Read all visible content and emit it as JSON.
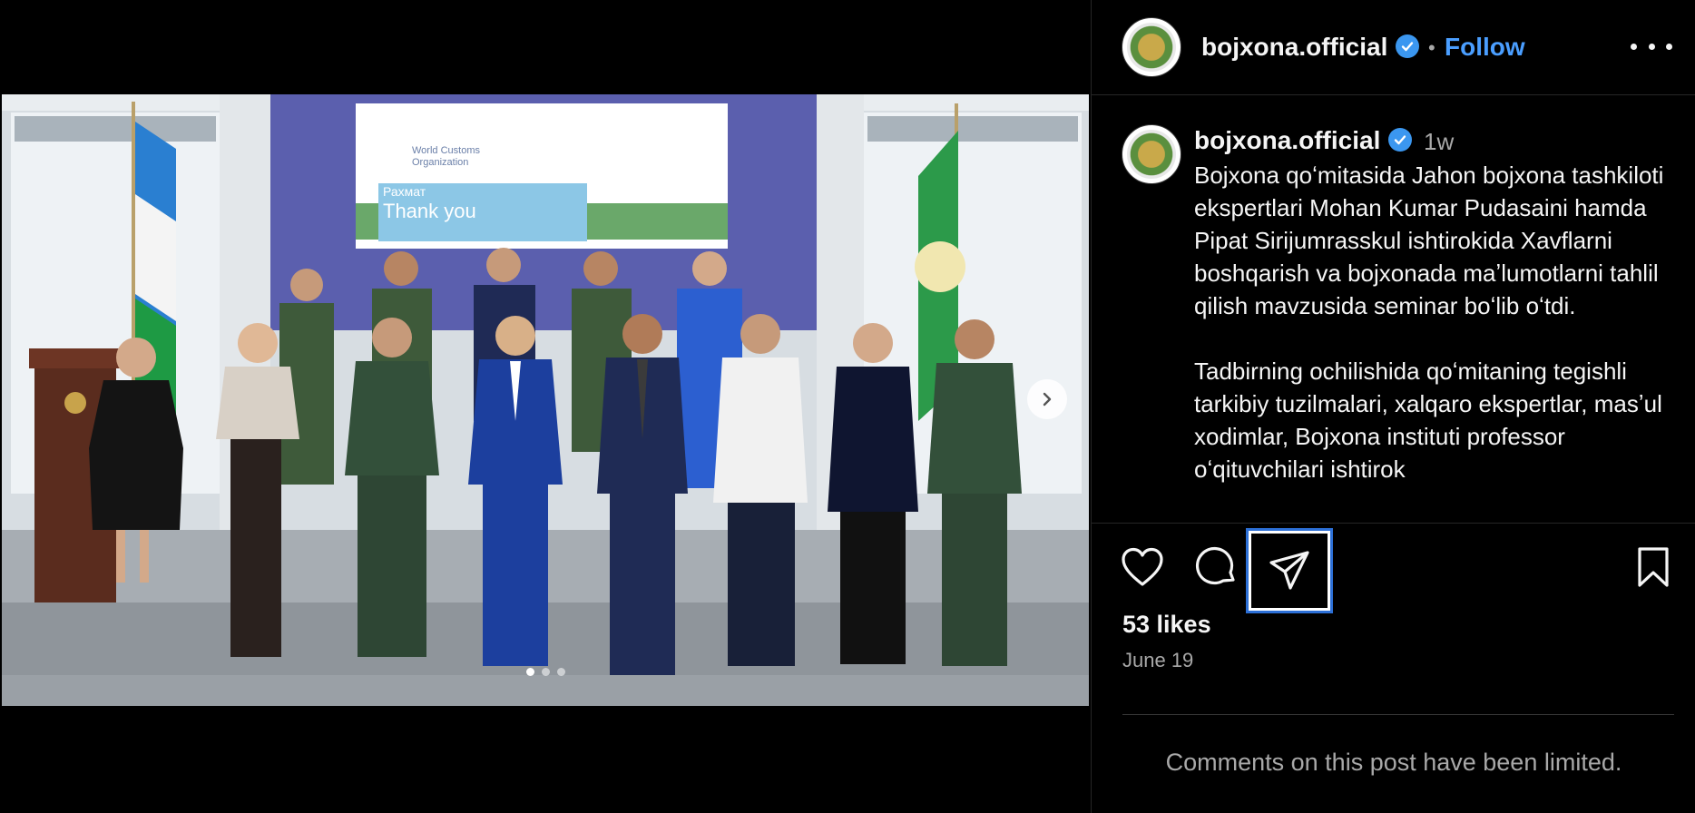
{
  "header": {
    "username": "bojxona.official",
    "follow_label": "Follow",
    "separator": "•"
  },
  "post": {
    "username": "bojxona.official",
    "time_ago": "1w",
    "caption": "Bojxona qoʻmitasida Jahon bojxona tashkiloti ekspertlari Mohan Kumar Pudasaini hamda Pipat Sirijumrasskul ishtirokida Xavflarni boshqarish va bojxonada maʼlumotlarni tahlil qilish mavzusida seminar boʻlib oʻtdi.\n\nTadbirning ochilishida qoʻmitaning tegishli tarkibiy tuzilmalari, xalqaro ekspertlar, masʼul xodimlar, Bojxona instituti professor oʻqituvchilari ishtirok",
    "likes": "53 likes",
    "date": "June 19",
    "comments_notice": "Comments on this post have been limited."
  },
  "media": {
    "slide_count": 3,
    "active_slide": 1,
    "screen_text_line1": "World Customs",
    "screen_text_line2": "Organization",
    "screen_banner_small": "Рахмат",
    "screen_banner_big": "Thank you"
  },
  "icons": {
    "verified": "verified-badge-icon",
    "more": "more-options-icon",
    "like": "heart-icon",
    "comment": "comment-bubble-icon",
    "share": "paper-plane-icon",
    "save": "bookmark-icon",
    "next": "chevron-right-icon"
  },
  "colors": {
    "background": "#000000",
    "accent": "#4a9eff",
    "verified": "#3b97f0",
    "muted_text": "#a8a8a8",
    "focus_outline": "#2c6fd6"
  }
}
